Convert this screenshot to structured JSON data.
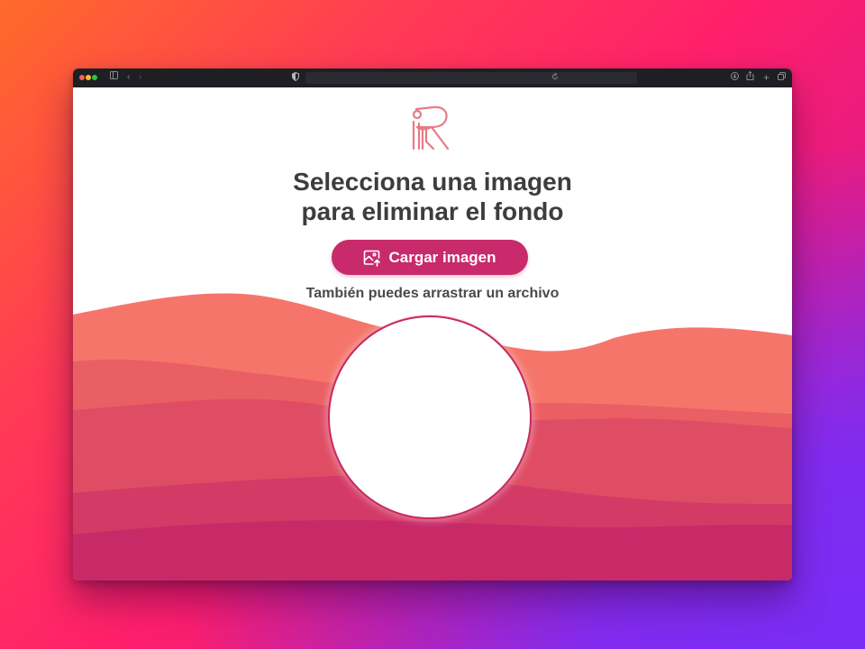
{
  "app": {
    "heading": "Selecciona una imagen para eliminar el fondo",
    "upload_button_label": "Cargar imagen",
    "drag_hint": "También puedes arrastrar un archivo"
  },
  "icons": {
    "logo": "r-figure-logo",
    "upload": "image-upload-icon",
    "address_bar": "shield-icon"
  },
  "colors": {
    "accent": "#c82a6b",
    "heading_text": "#3d3d3d",
    "wave_1": "#f5756a",
    "wave_2": "#ea5f64",
    "wave_3": "#df4d64",
    "wave_4": "#d33a66",
    "wave_5": "#c82a68"
  }
}
